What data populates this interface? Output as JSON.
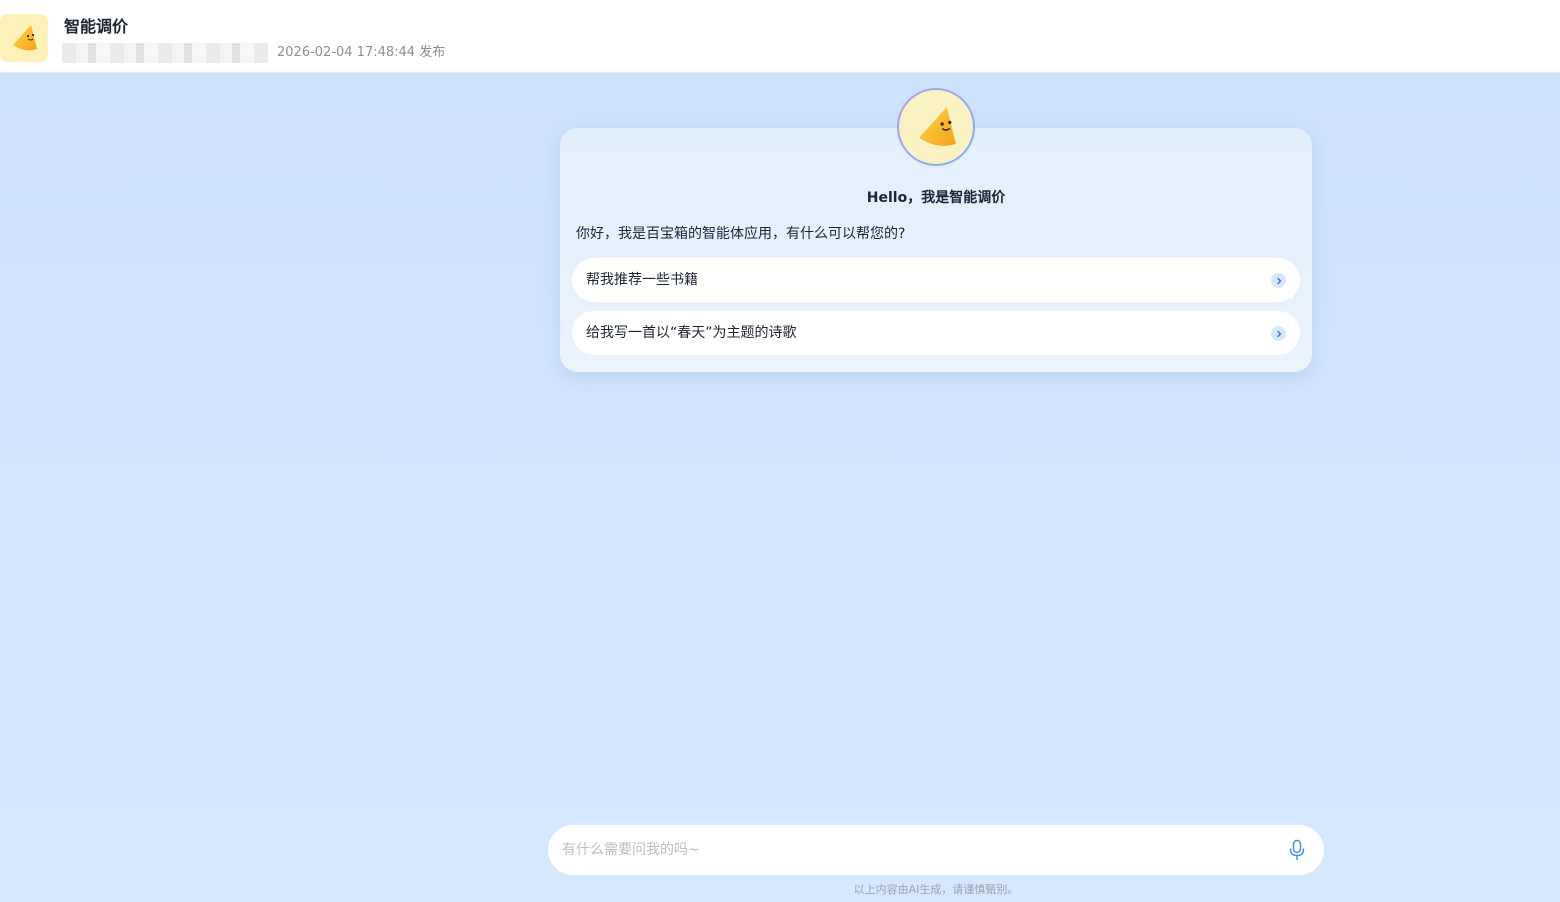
{
  "header": {
    "app_title": "智能调价",
    "publish_time": "2026-02-04 17:48:44 发布",
    "logo_icon": "cone-mascot-icon"
  },
  "welcome": {
    "title": "Hello，我是智能调价",
    "intro": "你好，我是百宝箱的智能体应用，有什么可以帮您的?",
    "suggestions": [
      {
        "label": "帮我推荐一些书籍"
      },
      {
        "label": "给我写一首以“春天”为主题的诗歌"
      }
    ]
  },
  "input": {
    "placeholder": "有什么需要问我的吗~",
    "value": "",
    "mic_icon": "microphone-icon"
  },
  "footer": {
    "disclaimer": "以上内容由AI生成，请谨慎甄别。"
  },
  "colors": {
    "background": "#cce2fb",
    "card": "#e2effd",
    "accent": "#4a90e2",
    "logo_bg": "#fdf0b8"
  }
}
